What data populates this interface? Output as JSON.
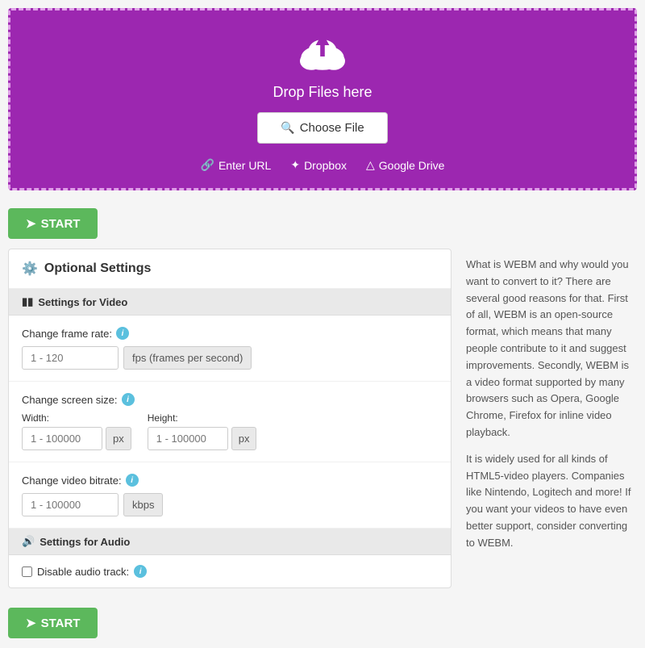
{
  "dropzone": {
    "drop_text": "Drop Files here",
    "choose_file_label": "Choose File",
    "enter_url_label": "Enter URL",
    "dropbox_label": "Dropbox",
    "google_drive_label": "Google Drive"
  },
  "start_button": {
    "label": "START"
  },
  "settings": {
    "title": "Optional Settings",
    "video_section": {
      "header": "Settings for Video",
      "frame_rate": {
        "label": "Change frame rate:",
        "placeholder": "1 - 120",
        "unit": "fps (frames per second)"
      },
      "screen_size": {
        "label": "Change screen size:",
        "width_label": "Width:",
        "width_placeholder": "1 - 100000",
        "height_label": "Height:",
        "height_placeholder": "1 - 100000",
        "unit": "px"
      },
      "bitrate": {
        "label": "Change video bitrate:",
        "placeholder": "1 - 100000",
        "unit": "kbps"
      }
    },
    "audio_section": {
      "header": "Settings for Audio",
      "disable_audio_label": "Disable audio track:"
    }
  },
  "info_panel": {
    "paragraphs": [
      "What is WEBM and why would you want to convert to it? There are several good reasons for that. First of all, WEBM is an open-source format, which means that many people contribute to it and suggest improvements. Secondly, WEBM is a video format supported by many browsers such as Opera, Google Chrome, Firefox for inline video playback.",
      "It is widely used for all kinds of HTML5-video players. Companies like Nintendo, Logitech and more! If you want your videos to have even better support, consider converting to WEBM."
    ]
  }
}
